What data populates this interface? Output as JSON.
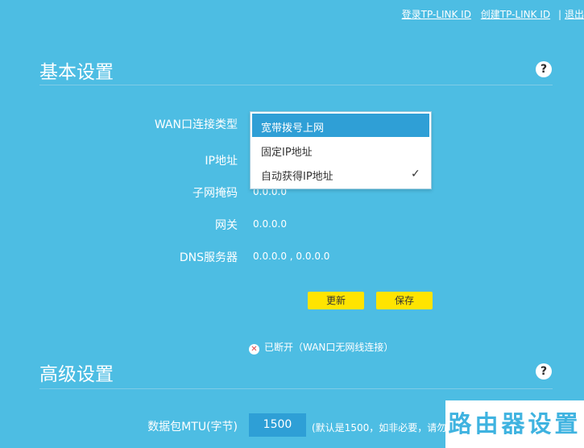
{
  "top_links": {
    "login": "登录TP-LINK ID",
    "create": "创建TP-LINK ID",
    "sep": "|",
    "logout": "退出"
  },
  "basic": {
    "title": "基本设置",
    "help": "?",
    "fields": {
      "wan_type_label": "WAN口连接类型",
      "ip_label": "IP地址",
      "mask_label": "子网掩码",
      "mask_value": "0.0.0.0",
      "gateway_label": "网关",
      "gateway_value": "0.0.0.0",
      "dns_label": "DNS服务器",
      "dns_value": "0.0.0.0 , 0.0.0.0"
    },
    "wan_options": [
      "宽带拨号上网",
      "固定IP地址",
      "自动获得IP地址"
    ],
    "wan_selected": "自动获得IP地址",
    "check_glyph": "✓",
    "buttons": {
      "refresh": "更新",
      "save": "保存"
    },
    "status": {
      "icon": "✕",
      "text": "已断开（WAN口无网线连接）"
    }
  },
  "advanced": {
    "title": "高级设置",
    "help": "?",
    "mtu_label": "数据包MTU(字节)",
    "mtu_value": "1500",
    "mtu_hint": "(默认是1500，如非必要，请勿修改)"
  },
  "watermark": "路由器设置",
  "colors": {
    "background": "#4dbde3",
    "highlight": "#2f9fd6",
    "button": "#ffe400",
    "status_icon": "#e0484a",
    "watermark_text": "#3fb3e0"
  }
}
